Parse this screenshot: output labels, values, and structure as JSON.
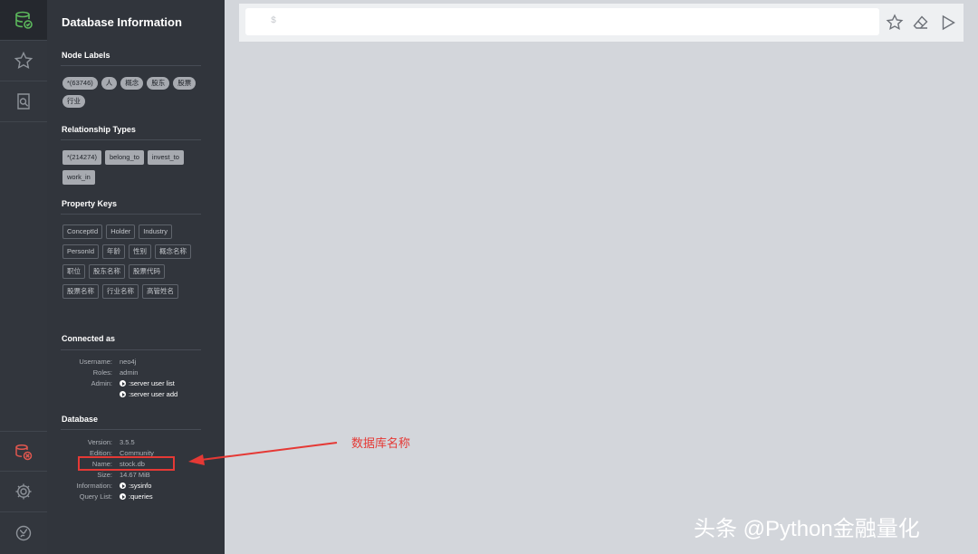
{
  "panel": {
    "title": "Database Information",
    "node_labels": {
      "heading": "Node Labels",
      "items": [
        "*(63746)",
        "人",
        "概念",
        "股东",
        "股票",
        "行业"
      ]
    },
    "relationship_types": {
      "heading": "Relationship Types",
      "items": [
        "*(214274)",
        "belong_to",
        "invest_to",
        "work_in"
      ]
    },
    "property_keys": {
      "heading": "Property Keys",
      "items": [
        "ConceptId",
        "Holder",
        "Industry",
        "PersonId",
        "年龄",
        "性别",
        "概念名称",
        "职位",
        "股东名称",
        "股票代码",
        "股票名称",
        "行业名称",
        "高管姓名"
      ]
    },
    "connected_as": {
      "heading": "Connected as",
      "username_label": "Username:",
      "username": "neo4j",
      "roles_label": "Roles:",
      "roles": "admin",
      "admin_label": "Admin:",
      "admin_link1": ":server user list",
      "admin_link2": ":server user add"
    },
    "database": {
      "heading": "Database",
      "version_label": "Version:",
      "version": "3.5.5",
      "edition_label": "Edition:",
      "edition": "Community",
      "name_label": "Name:",
      "name": "stock.db",
      "size_label": "Size:",
      "size": "14.67 MiB",
      "information_label": "Information:",
      "information": ":sysinfo",
      "query_list_label": "Query List:",
      "query_list": ":queries"
    }
  },
  "editor": {
    "prompt": "$"
  },
  "annotation": {
    "text": "数据库名称",
    "color": "#e53935"
  },
  "watermark": "头条 @Python金融量化",
  "colors": {
    "accent_green": "#5cb85c",
    "alert_red": "#e0574f",
    "annotation_red": "#e53935"
  },
  "icons": {
    "rail": [
      "database-icon",
      "star-icon",
      "search-document-icon",
      "disconnected-icon",
      "gear-icon",
      "neo4j-browser-icon"
    ],
    "toolbar": [
      "star-icon",
      "eraser-icon",
      "play-icon"
    ]
  }
}
